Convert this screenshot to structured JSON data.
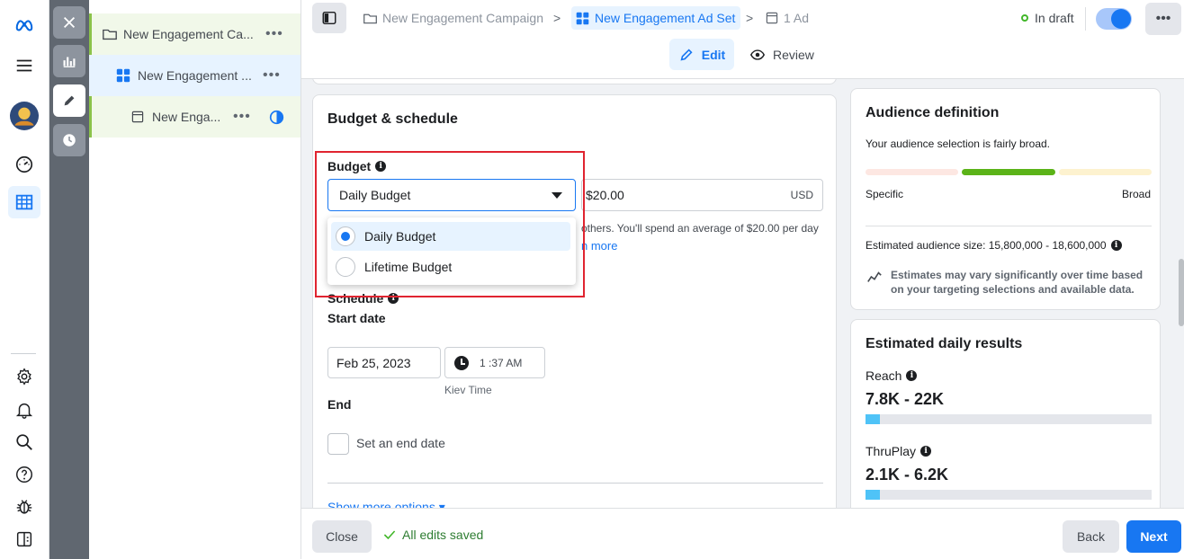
{
  "tree": {
    "campaign": "New Engagement Ca...",
    "ad_set": "New Engagement ...",
    "ad": "New Enga...",
    "more": "•••"
  },
  "header": {
    "crumb_campaign": "New Engagement Campaign",
    "crumb_ad_set": "New Engagement Ad Set",
    "crumb_ad": "1 Ad",
    "chevron": ">",
    "status": "In draft",
    "more": "•••",
    "edit": "Edit",
    "review": "Review"
  },
  "budget": {
    "section_title": "Budget & schedule",
    "label": "Budget",
    "selected": "Daily Budget",
    "amount": "$20.00",
    "currency": "USD",
    "help_text": "others. You'll spend an average of $20.00 per day",
    "help_link": "n more",
    "options": [
      "Daily Budget",
      "Lifetime Budget"
    ],
    "schedule_label": "Schedule",
    "start_date_label": "Start date",
    "start_date": "Feb 25, 2023",
    "start_time": "1 :37 AM",
    "timezone": "Kiev Time",
    "end_label": "End",
    "end_checkbox": "Set an end date",
    "show_more": "Show more options ▾"
  },
  "audience": {
    "title": "Audience definition",
    "desc": "Your audience selection is fairly broad.",
    "specific": "Specific",
    "broad": "Broad",
    "size": "Estimated audience size: 15,800,000 - 18,600,000",
    "note": "Estimates may vary significantly over time based on your targeting selections and available data."
  },
  "results": {
    "title": "Estimated daily results",
    "reach_label": "Reach",
    "reach_value": "7.8K - 22K",
    "reach_fill": 0.05,
    "thruplay_label": "ThruPlay",
    "thruplay_value": "2.1K - 6.2K",
    "thruplay_fill": 0.05
  },
  "footer": {
    "close": "Close",
    "saved": "All edits saved",
    "back": "Back",
    "next": "Next"
  },
  "colors": {
    "accent": "#1877f2",
    "draft": "#42b72a",
    "highlight": "#e02430"
  }
}
